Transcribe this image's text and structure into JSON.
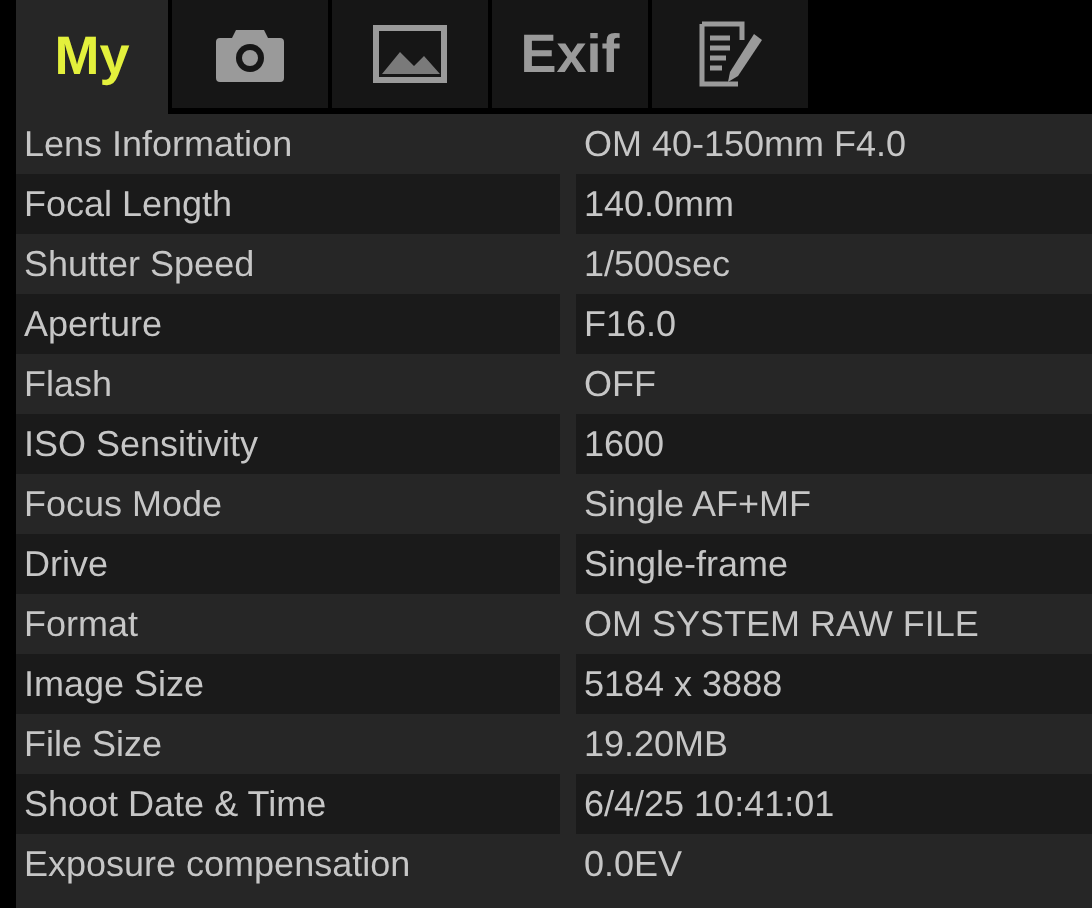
{
  "tabs": [
    {
      "kind": "text",
      "label": "My",
      "selected": true
    },
    {
      "kind": "camera",
      "selected": false
    },
    {
      "kind": "image",
      "selected": false
    },
    {
      "kind": "text",
      "label": "Exif",
      "selected": false
    },
    {
      "kind": "notes",
      "selected": false
    }
  ],
  "rows": [
    {
      "label": "Lens Information",
      "value": "OM 40-150mm F4.0"
    },
    {
      "label": "Focal Length",
      "value": "140.0mm"
    },
    {
      "label": "Shutter Speed",
      "value": "1/500sec"
    },
    {
      "label": "Aperture",
      "value": "F16.0"
    },
    {
      "label": "Flash",
      "value": "OFF"
    },
    {
      "label": "ISO Sensitivity",
      "value": "1600"
    },
    {
      "label": "Focus Mode",
      "value": "Single AF+MF"
    },
    {
      "label": "Drive",
      "value": "Single-frame"
    },
    {
      "label": "Format",
      "value": "OM SYSTEM RAW FILE"
    },
    {
      "label": "Image Size",
      "value": "5184 x 3888"
    },
    {
      "label": "File Size",
      "value": "19.20MB"
    },
    {
      "label": "Shoot Date & Time",
      "value": "6/4/25 10:41:01"
    },
    {
      "label": "Exposure compensation",
      "value": "0.0EV"
    }
  ]
}
